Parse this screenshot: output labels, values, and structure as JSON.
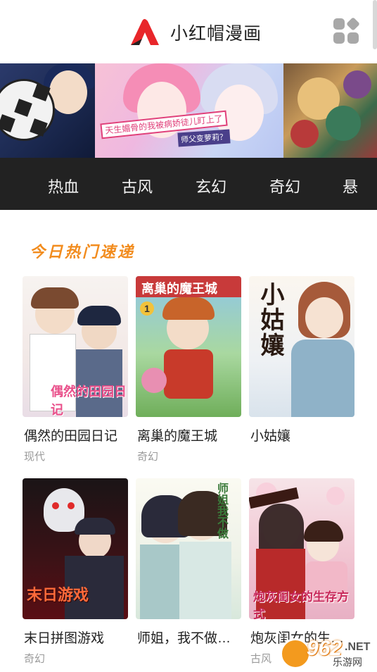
{
  "header": {
    "app_title": "小红帽漫画",
    "logo_icon": "red-hat-logo-icon",
    "menu_icon": "grid-menu-icon",
    "logo_color": "#e8262a"
  },
  "banner": {
    "slide_2_tag": "天生媚骨的我被病娇徒儿盯上了",
    "slide_2_tag_b": "师父变萝莉？"
  },
  "categories": [
    "热血",
    "古风",
    "玄幻",
    "奇幻",
    "悬"
  ],
  "section": {
    "title": "今日热门速递",
    "accent": "#f28c1e"
  },
  "comics": [
    {
      "title": "偶然的田园日记",
      "genre": "现代",
      "cover_text": "偶然的田园日记"
    },
    {
      "title": "离巢的魔王城",
      "genre": "奇幻",
      "cover_text": "离巢的魔王城"
    },
    {
      "title": "小姑孃",
      "genre": "",
      "cover_text": "小姑孃"
    },
    {
      "title": "末日拼图游戏",
      "genre": "奇幻",
      "cover_text": "末日游戏"
    },
    {
      "title": "师姐，我不做…",
      "genre": "",
      "cover_text": "师姐我不做"
    },
    {
      "title": "炮灰闺女的生…",
      "genre": "古风",
      "cover_text": "炮灰闺女的生存方式"
    }
  ],
  "watermark": {
    "number": "962",
    "net": ".NET",
    "sub": "乐游网"
  }
}
